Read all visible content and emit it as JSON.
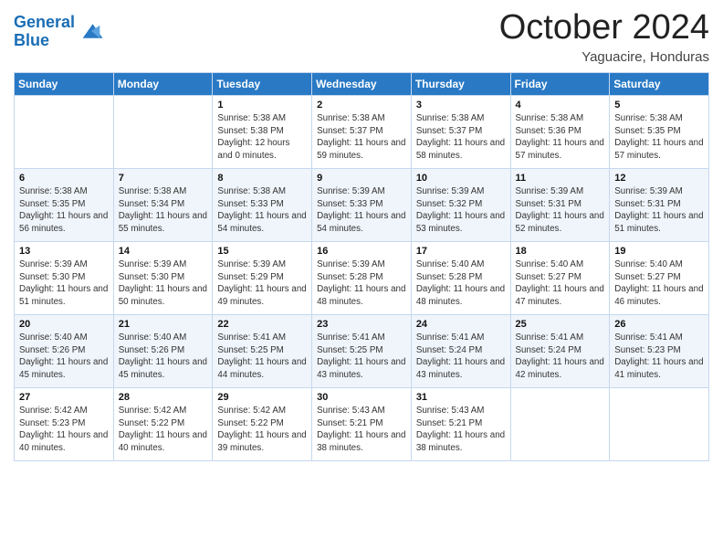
{
  "logo": {
    "line1": "General",
    "line2": "Blue"
  },
  "header": {
    "month": "October 2024",
    "location": "Yaguacire, Honduras"
  },
  "weekdays": [
    "Sunday",
    "Monday",
    "Tuesday",
    "Wednesday",
    "Thursday",
    "Friday",
    "Saturday"
  ],
  "weeks": [
    [
      {
        "day": "",
        "info": ""
      },
      {
        "day": "",
        "info": ""
      },
      {
        "day": "1",
        "info": "Sunrise: 5:38 AM\nSunset: 5:38 PM\nDaylight: 12 hours and 0 minutes."
      },
      {
        "day": "2",
        "info": "Sunrise: 5:38 AM\nSunset: 5:37 PM\nDaylight: 11 hours and 59 minutes."
      },
      {
        "day": "3",
        "info": "Sunrise: 5:38 AM\nSunset: 5:37 PM\nDaylight: 11 hours and 58 minutes."
      },
      {
        "day": "4",
        "info": "Sunrise: 5:38 AM\nSunset: 5:36 PM\nDaylight: 11 hours and 57 minutes."
      },
      {
        "day": "5",
        "info": "Sunrise: 5:38 AM\nSunset: 5:35 PM\nDaylight: 11 hours and 57 minutes."
      }
    ],
    [
      {
        "day": "6",
        "info": "Sunrise: 5:38 AM\nSunset: 5:35 PM\nDaylight: 11 hours and 56 minutes."
      },
      {
        "day": "7",
        "info": "Sunrise: 5:38 AM\nSunset: 5:34 PM\nDaylight: 11 hours and 55 minutes."
      },
      {
        "day": "8",
        "info": "Sunrise: 5:38 AM\nSunset: 5:33 PM\nDaylight: 11 hours and 54 minutes."
      },
      {
        "day": "9",
        "info": "Sunrise: 5:39 AM\nSunset: 5:33 PM\nDaylight: 11 hours and 54 minutes."
      },
      {
        "day": "10",
        "info": "Sunrise: 5:39 AM\nSunset: 5:32 PM\nDaylight: 11 hours and 53 minutes."
      },
      {
        "day": "11",
        "info": "Sunrise: 5:39 AM\nSunset: 5:31 PM\nDaylight: 11 hours and 52 minutes."
      },
      {
        "day": "12",
        "info": "Sunrise: 5:39 AM\nSunset: 5:31 PM\nDaylight: 11 hours and 51 minutes."
      }
    ],
    [
      {
        "day": "13",
        "info": "Sunrise: 5:39 AM\nSunset: 5:30 PM\nDaylight: 11 hours and 51 minutes."
      },
      {
        "day": "14",
        "info": "Sunrise: 5:39 AM\nSunset: 5:30 PM\nDaylight: 11 hours and 50 minutes."
      },
      {
        "day": "15",
        "info": "Sunrise: 5:39 AM\nSunset: 5:29 PM\nDaylight: 11 hours and 49 minutes."
      },
      {
        "day": "16",
        "info": "Sunrise: 5:39 AM\nSunset: 5:28 PM\nDaylight: 11 hours and 48 minutes."
      },
      {
        "day": "17",
        "info": "Sunrise: 5:40 AM\nSunset: 5:28 PM\nDaylight: 11 hours and 48 minutes."
      },
      {
        "day": "18",
        "info": "Sunrise: 5:40 AM\nSunset: 5:27 PM\nDaylight: 11 hours and 47 minutes."
      },
      {
        "day": "19",
        "info": "Sunrise: 5:40 AM\nSunset: 5:27 PM\nDaylight: 11 hours and 46 minutes."
      }
    ],
    [
      {
        "day": "20",
        "info": "Sunrise: 5:40 AM\nSunset: 5:26 PM\nDaylight: 11 hours and 45 minutes."
      },
      {
        "day": "21",
        "info": "Sunrise: 5:40 AM\nSunset: 5:26 PM\nDaylight: 11 hours and 45 minutes."
      },
      {
        "day": "22",
        "info": "Sunrise: 5:41 AM\nSunset: 5:25 PM\nDaylight: 11 hours and 44 minutes."
      },
      {
        "day": "23",
        "info": "Sunrise: 5:41 AM\nSunset: 5:25 PM\nDaylight: 11 hours and 43 minutes."
      },
      {
        "day": "24",
        "info": "Sunrise: 5:41 AM\nSunset: 5:24 PM\nDaylight: 11 hours and 43 minutes."
      },
      {
        "day": "25",
        "info": "Sunrise: 5:41 AM\nSunset: 5:24 PM\nDaylight: 11 hours and 42 minutes."
      },
      {
        "day": "26",
        "info": "Sunrise: 5:41 AM\nSunset: 5:23 PM\nDaylight: 11 hours and 41 minutes."
      }
    ],
    [
      {
        "day": "27",
        "info": "Sunrise: 5:42 AM\nSunset: 5:23 PM\nDaylight: 11 hours and 40 minutes."
      },
      {
        "day": "28",
        "info": "Sunrise: 5:42 AM\nSunset: 5:22 PM\nDaylight: 11 hours and 40 minutes."
      },
      {
        "day": "29",
        "info": "Sunrise: 5:42 AM\nSunset: 5:22 PM\nDaylight: 11 hours and 39 minutes."
      },
      {
        "day": "30",
        "info": "Sunrise: 5:43 AM\nSunset: 5:21 PM\nDaylight: 11 hours and 38 minutes."
      },
      {
        "day": "31",
        "info": "Sunrise: 5:43 AM\nSunset: 5:21 PM\nDaylight: 11 hours and 38 minutes."
      },
      {
        "day": "",
        "info": ""
      },
      {
        "day": "",
        "info": ""
      }
    ]
  ]
}
